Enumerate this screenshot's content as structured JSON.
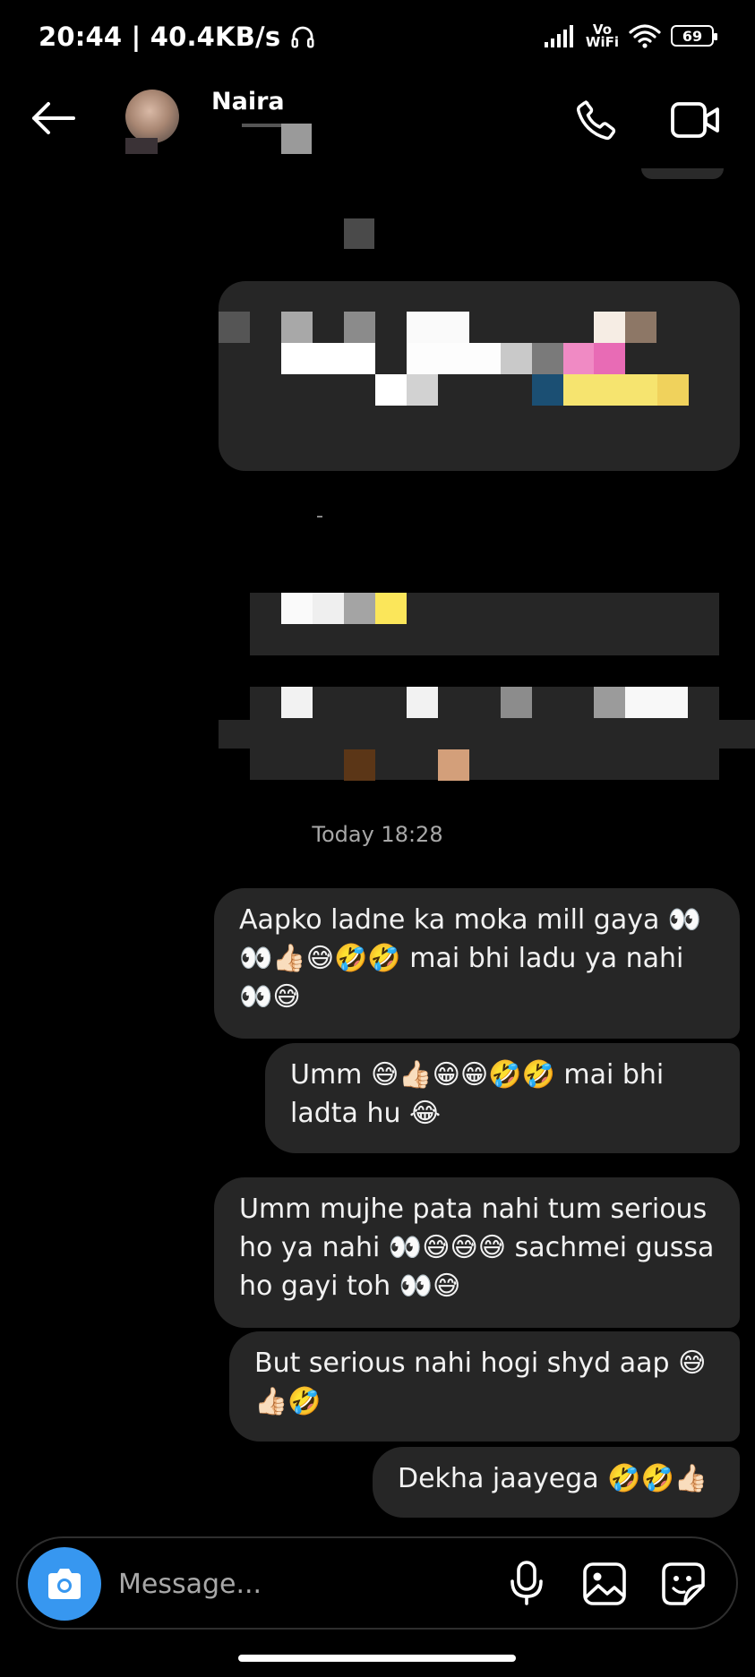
{
  "status_bar": {
    "time_speed": "20:44 | 40.4KB/s",
    "network_label_top": "Vo",
    "network_label_bottom": "WiFi",
    "battery": "69"
  },
  "header": {
    "contact_name": "Naira"
  },
  "chat": {
    "timestamp": "Today 18:28",
    "messages": [
      {
        "text": "Aapko ladne ka moka mill gaya 👀👀👍🏻😅🤣🤣 mai bhi ladu ya nahi 👀😅"
      },
      {
        "text": "Umm 😅👍🏻😁😁🤣🤣 mai bhi ladta hu 😂"
      },
      {
        "text": "Umm mujhe pata nahi tum serious ho ya nahi 👀😅😅😅 sachmei gussa ho gayi toh 👀😅"
      },
      {
        "text": "But serious nahi hogi shyd aap 😅👍🏻🤣"
      },
      {
        "text": "Dekha jaayega 🤣🤣👍🏻"
      }
    ]
  },
  "composer": {
    "placeholder": "Message..."
  },
  "colors": {
    "background": "#000000",
    "bubble": "#262626",
    "accent": "#3797f0",
    "timestamp": "#a8a8a8"
  },
  "icons": [
    "headphone-icon",
    "signal-icon",
    "wifi-icon",
    "battery-icon",
    "back-arrow-icon",
    "phone-icon",
    "video-camera-icon",
    "camera-icon",
    "microphone-icon",
    "gallery-icon",
    "sticker-icon"
  ]
}
